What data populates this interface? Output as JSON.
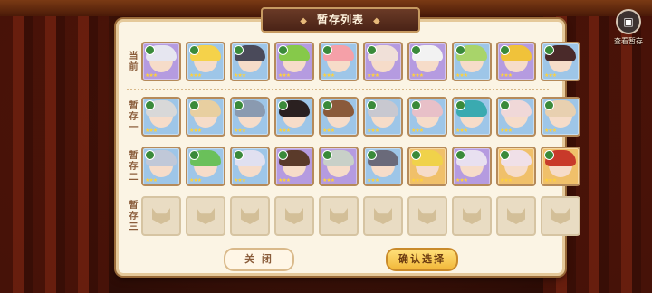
{
  "title": "暂存列表",
  "view_button": {
    "icon": "box-icon",
    "label": "查看暂存"
  },
  "rows": [
    {
      "label": "当前",
      "cards": [
        {
          "bg": "#b59be0",
          "hair": "#e6e6f0"
        },
        {
          "bg": "#9ec6e8",
          "hair": "#f5d24a"
        },
        {
          "bg": "#9ec6e8",
          "hair": "#4a4a5a"
        },
        {
          "bg": "#b59be0",
          "hair": "#86c94a"
        },
        {
          "bg": "#9ec6e8",
          "hair": "#f5a0a8"
        },
        {
          "bg": "#b59be0",
          "hair": "#f0e0d8"
        },
        {
          "bg": "#b59be0",
          "hair": "#f2f2f2"
        },
        {
          "bg": "#9ec6e8",
          "hair": "#a8d46a"
        },
        {
          "bg": "#b59be0",
          "hair": "#f0c23a"
        },
        {
          "bg": "#9ec6e8",
          "hair": "#4a2a2a"
        }
      ]
    },
    {
      "label": "暂存一",
      "cards": [
        {
          "bg": "#9ec6e8",
          "hair": "#d8d8d8"
        },
        {
          "bg": "#9ec6e8",
          "hair": "#e8cfa0"
        },
        {
          "bg": "#9ec6e8",
          "hair": "#8a9ab0"
        },
        {
          "bg": "#9ec6e8",
          "hair": "#2a2020"
        },
        {
          "bg": "#9ec6e8",
          "hair": "#8a5a3a"
        },
        {
          "bg": "#9ec6e8",
          "hair": "#c8c8d0"
        },
        {
          "bg": "#9ec6e8",
          "hair": "#e8c0c8"
        },
        {
          "bg": "#9ec6e8",
          "hair": "#3aaab0"
        },
        {
          "bg": "#9ec6e8",
          "hair": "#f0d8d8"
        },
        {
          "bg": "#9ec6e8",
          "hair": "#e8d0b0"
        }
      ]
    },
    {
      "label": "暂存二",
      "cards": [
        {
          "bg": "#9ec6e8",
          "hair": "#c0c8d8"
        },
        {
          "bg": "#9ec6e8",
          "hair": "#6ac05a"
        },
        {
          "bg": "#9ec6e8",
          "hair": "#e0e0f0"
        },
        {
          "bg": "#b59be0",
          "hair": "#5a3a2a"
        },
        {
          "bg": "#b59be0",
          "hair": "#c8d0c8"
        },
        {
          "bg": "#9ec6e8",
          "hair": "#6a6a7a"
        },
        {
          "bg": "#f0c06a",
          "hair": "#f0d24a"
        },
        {
          "bg": "#b59be0",
          "hair": "#e8e0f0"
        },
        {
          "bg": "#f0c06a",
          "hair": "#f0e0e8"
        },
        {
          "bg": "#f0c06a",
          "hair": "#c83a2a"
        }
      ]
    },
    {
      "label": "暂存三",
      "cards": [
        {},
        {},
        {},
        {},
        {},
        {},
        {},
        {},
        {},
        {}
      ],
      "empty": true
    }
  ],
  "buttons": {
    "close": "关 闭",
    "confirm": "确认选择"
  }
}
